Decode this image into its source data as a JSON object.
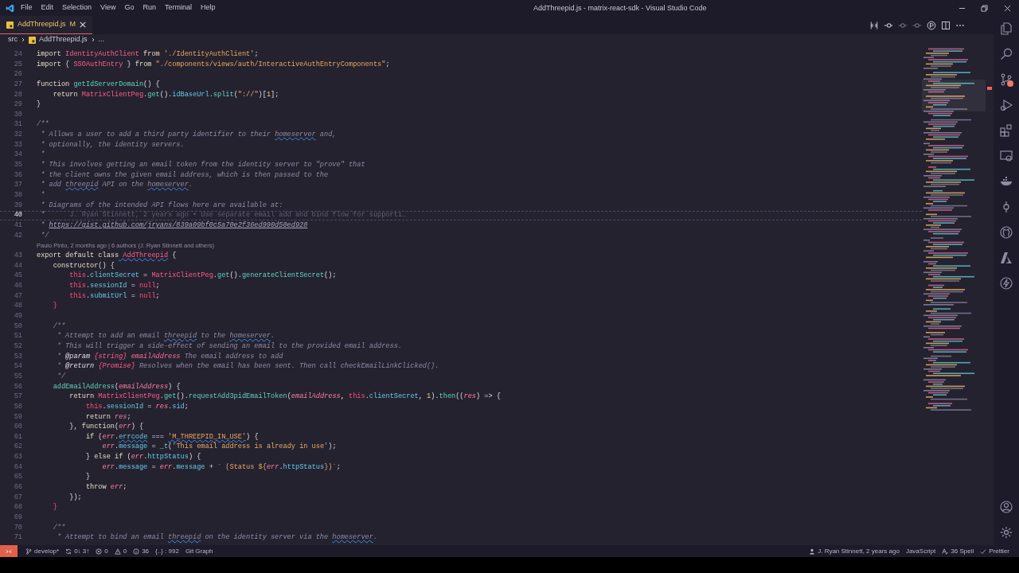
{
  "window": {
    "title": "AddThreepid.js - matrix-react-sdk - Visual Studio Code"
  },
  "menu": [
    "File",
    "Edit",
    "Selection",
    "View",
    "Go",
    "Run",
    "Terminal",
    "Help"
  ],
  "tabs": [
    {
      "label": "AddThreepid.js",
      "status": "M",
      "selected": true
    }
  ],
  "breadcrumb": [
    "src",
    "AddThreepid.js",
    "..."
  ],
  "editor": {
    "lines": [
      {
        "kind": "code",
        "number": "24",
        "current": false,
        "tokens": [
          {
            "kind": "kw",
            "text": "import"
          },
          {
            "kind": "cls",
            "text": " IdentityAuthClient"
          },
          {
            "kind": "kw",
            "text": " from"
          },
          {
            "kind": "str",
            "text": " './IdentityAuthClient'"
          },
          {
            "kind": "p",
            "text": ";"
          }
        ]
      },
      {
        "kind": "code",
        "number": "25",
        "current": false,
        "tokens": [
          {
            "kind": "kw",
            "text": "import"
          },
          {
            "kind": "p",
            "text": " { "
          },
          {
            "kind": "cls",
            "text": "SSOAuthEntry"
          },
          {
            "kind": "p",
            "text": " } "
          },
          {
            "kind": "kw",
            "text": "from"
          },
          {
            "kind": "str",
            "text": " \"./components/views/auth/InteractiveAuthEntryComponents\""
          },
          {
            "kind": "p",
            "text": ";"
          }
        ]
      },
      {
        "kind": "code",
        "number": "26",
        "current": false
      },
      {
        "kind": "code",
        "number": "27",
        "current": false,
        "tokens": [
          {
            "kind": "kw",
            "text": "function"
          },
          {
            "kind": "fn",
            "text": " getIdServerDomain"
          },
          {
            "kind": "p",
            "text": "() {"
          }
        ]
      },
      {
        "kind": "code",
        "number": "28",
        "current": false,
        "tokens": [
          {
            "kind": "kw",
            "text": "    return"
          },
          {
            "kind": "cls",
            "text": " MatrixClientPeg"
          },
          {
            "kind": "p",
            "text": "."
          },
          {
            "kind": "fn",
            "text": "get"
          },
          {
            "kind": "p",
            "text": "()."
          },
          {
            "kind": "prop",
            "text": "idBaseUrl"
          },
          {
            "kind": "p",
            "text": "."
          },
          {
            "kind": "fn",
            "text": "split"
          },
          {
            "kind": "p",
            "text": "("
          },
          {
            "kind": "str",
            "text": "\"://\""
          },
          {
            "kind": "p",
            "text": ")["
          },
          {
            "kind": "num",
            "text": "1"
          },
          {
            "kind": "p",
            "text": "];"
          }
        ]
      },
      {
        "kind": "code",
        "number": "29",
        "current": false,
        "tokens": [
          {
            "kind": "p",
            "text": "}"
          }
        ]
      },
      {
        "kind": "code",
        "number": "30",
        "current": false
      },
      {
        "kind": "code",
        "number": "31",
        "current": false,
        "tokens": [
          {
            "kind": "cmt",
            "text": "/**"
          }
        ]
      },
      {
        "kind": "code",
        "number": "32",
        "current": false,
        "tokens": [
          {
            "kind": "cmt",
            "text": " * Allows a user to add a third party identifier to their "
          },
          {
            "kind": "cmtspell",
            "text": "homeserver"
          },
          {
            "kind": "cmt",
            "text": " and,"
          }
        ]
      },
      {
        "kind": "code",
        "number": "33",
        "current": false,
        "tokens": [
          {
            "kind": "cmt",
            "text": " * optionally, the identity servers."
          }
        ]
      },
      {
        "kind": "code",
        "number": "34",
        "current": false,
        "tokens": [
          {
            "kind": "cmt",
            "text": " *"
          }
        ]
      },
      {
        "kind": "code",
        "number": "35",
        "current": false,
        "tokens": [
          {
            "kind": "cmt",
            "text": " * This involves getting an email token from the identity server to \"prove\" that"
          }
        ]
      },
      {
        "kind": "code",
        "number": "36",
        "current": false,
        "tokens": [
          {
            "kind": "cmt",
            "text": " * the client owns the given email address, which is then passed to the"
          }
        ]
      },
      {
        "kind": "code",
        "number": "37",
        "current": false,
        "tokens": [
          {
            "kind": "cmt",
            "text": " * add "
          },
          {
            "kind": "cmtspell",
            "text": "threepid"
          },
          {
            "kind": "cmt",
            "text": " API on the "
          },
          {
            "kind": "cmtspell",
            "text": "homeserver"
          },
          {
            "kind": "cmt",
            "text": "."
          }
        ]
      },
      {
        "kind": "code",
        "number": "38",
        "current": false,
        "tokens": [
          {
            "kind": "cmt",
            "text": " *"
          }
        ]
      },
      {
        "kind": "code",
        "number": "39",
        "current": false,
        "tokens": [
          {
            "kind": "cmt",
            "text": " * Diagrams of the intended API flows here are available at:"
          }
        ]
      },
      {
        "kind": "code",
        "number": "40",
        "current": true,
        "tokens": [
          {
            "kind": "cmt",
            "text": " *"
          },
          {
            "kind": "ghost",
            "text": "      J. Ryan Stinnett, 2 years ago • Use separate email add and bind flow for supporti…"
          }
        ]
      },
      {
        "kind": "code",
        "number": "41",
        "current": false,
        "tokens": [
          {
            "kind": "cmt",
            "text": " * "
          },
          {
            "kind": "link",
            "text": "https://gist.github.com/jryans/839a09bf0c5a70e2f36ed990d50ed928"
          }
        ]
      },
      {
        "kind": "code",
        "number": "42",
        "current": false,
        "tokens": [
          {
            "kind": "cmt",
            "text": " */"
          }
        ]
      },
      {
        "kind": "codelens",
        "text": "Paulo Pinto, 2 months ago | 6 authors (J. Ryan Stinnett and others)"
      },
      {
        "kind": "code",
        "number": "43",
        "current": false,
        "tokens": [
          {
            "kind": "kw",
            "text": "export default class"
          },
          {
            "kind": "clsspell",
            "text": " AddThreepid"
          },
          {
            "kind": "p",
            "text": " {"
          }
        ]
      },
      {
        "kind": "code",
        "number": "44",
        "current": false,
        "tokens": [
          {
            "kind": "kw",
            "text": "    constructor"
          },
          {
            "kind": "p",
            "text": "() {"
          }
        ]
      },
      {
        "kind": "code",
        "number": "45",
        "current": false,
        "tokens": [
          {
            "kind": "this",
            "text": "        this"
          },
          {
            "kind": "p",
            "text": "."
          },
          {
            "kind": "prop",
            "text": "clientSecret"
          },
          {
            "kind": "p",
            "text": " = "
          },
          {
            "kind": "cls",
            "text": "MatrixClientPeg"
          },
          {
            "kind": "p",
            "text": "."
          },
          {
            "kind": "fn",
            "text": "get"
          },
          {
            "kind": "p",
            "text": "()."
          },
          {
            "kind": "fn",
            "text": "generateClientSecret"
          },
          {
            "kind": "p",
            "text": "();"
          }
        ]
      },
      {
        "kind": "code",
        "number": "46",
        "current": false,
        "tokens": [
          {
            "kind": "this",
            "text": "        this"
          },
          {
            "kind": "p",
            "text": "."
          },
          {
            "kind": "prop",
            "text": "sessionId"
          },
          {
            "kind": "p",
            "text": " = "
          },
          {
            "kind": "this",
            "text": "null"
          },
          {
            "kind": "p",
            "text": ";"
          }
        ]
      },
      {
        "kind": "code",
        "number": "47",
        "current": false,
        "tokens": [
          {
            "kind": "this",
            "text": "        this"
          },
          {
            "kind": "p",
            "text": "."
          },
          {
            "kind": "prop",
            "text": "submitUrl"
          },
          {
            "kind": "p",
            "text": " = "
          },
          {
            "kind": "this",
            "text": "null"
          },
          {
            "kind": "p",
            "text": ";"
          }
        ]
      },
      {
        "kind": "code",
        "number": "48",
        "current": false,
        "tokens": [
          {
            "kind": "brace",
            "text": "    }"
          }
        ]
      },
      {
        "kind": "code",
        "number": "49",
        "current": false
      },
      {
        "kind": "code",
        "number": "50",
        "current": false,
        "tokens": [
          {
            "kind": "cmt",
            "text": "    /**"
          }
        ]
      },
      {
        "kind": "code",
        "number": "51",
        "current": false,
        "tokens": [
          {
            "kind": "cmt",
            "text": "     * Attempt to add an email "
          },
          {
            "kind": "cmtspell",
            "text": "threepid"
          },
          {
            "kind": "cmt",
            "text": " to the "
          },
          {
            "kind": "cmtspell",
            "text": "homeserver"
          },
          {
            "kind": "cmt",
            "text": "."
          }
        ]
      },
      {
        "kind": "code",
        "number": "52",
        "current": false,
        "tokens": [
          {
            "kind": "cmt",
            "text": "     * This will trigger a side-effect of sending an email to the provided email address."
          }
        ]
      },
      {
        "kind": "code",
        "number": "53",
        "current": false,
        "tokens": [
          {
            "kind": "cmt",
            "text": "     * "
          },
          {
            "kind": "doctag",
            "text": "@param"
          },
          {
            "kind": "doctype",
            "text": " {string}"
          },
          {
            "kind": "docvar",
            "text": " emailAddress"
          },
          {
            "kind": "cmt",
            "text": " The email address to add"
          }
        ]
      },
      {
        "kind": "code",
        "number": "54",
        "current": false,
        "tokens": [
          {
            "kind": "cmt",
            "text": "     * "
          },
          {
            "kind": "doctag",
            "text": "@return"
          },
          {
            "kind": "doctype",
            "text": " {Promise}"
          },
          {
            "kind": "cmt",
            "text": " Resolves when the email has been sent. Then call checkEmailLinkClicked()."
          }
        ]
      },
      {
        "kind": "code",
        "number": "55",
        "current": false,
        "tokens": [
          {
            "kind": "cmt",
            "text": "     */"
          }
        ]
      },
      {
        "kind": "code",
        "number": "56",
        "current": false,
        "tokens": [
          {
            "kind": "fn",
            "text": "    addEmailAddress"
          },
          {
            "kind": "p",
            "text": "("
          },
          {
            "kind": "var",
            "text": "emailAddress"
          },
          {
            "kind": "p",
            "text": ") {"
          }
        ]
      },
      {
        "kind": "code",
        "number": "57",
        "current": false,
        "tokens": [
          {
            "kind": "kw",
            "text": "        return"
          },
          {
            "kind": "cls",
            "text": " MatrixClientPeg"
          },
          {
            "kind": "p",
            "text": "."
          },
          {
            "kind": "fn",
            "text": "get"
          },
          {
            "kind": "p",
            "text": "()."
          },
          {
            "kind": "fn",
            "text": "requestAdd3pidEmailToken"
          },
          {
            "kind": "p",
            "text": "("
          },
          {
            "kind": "var",
            "text": "emailAddress"
          },
          {
            "kind": "p",
            "text": ", "
          },
          {
            "kind": "this",
            "text": "this"
          },
          {
            "kind": "p",
            "text": "."
          },
          {
            "kind": "prop",
            "text": "clientSecret"
          },
          {
            "kind": "p",
            "text": ", "
          },
          {
            "kind": "num",
            "text": "1"
          },
          {
            "kind": "p",
            "text": ")."
          },
          {
            "kind": "fn",
            "text": "then"
          },
          {
            "kind": "p",
            "text": "(("
          },
          {
            "kind": "var",
            "text": "res"
          },
          {
            "kind": "p",
            "text": ") => {"
          }
        ]
      },
      {
        "kind": "code",
        "number": "58",
        "current": false,
        "tokens": [
          {
            "kind": "this",
            "text": "            this"
          },
          {
            "kind": "p",
            "text": "."
          },
          {
            "kind": "prop",
            "text": "sessionId"
          },
          {
            "kind": "p",
            "text": " = "
          },
          {
            "kind": "var",
            "text": "res"
          },
          {
            "kind": "p",
            "text": "."
          },
          {
            "kind": "prop",
            "text": "sid"
          },
          {
            "kind": "p",
            "text": ";"
          }
        ]
      },
      {
        "kind": "code",
        "number": "59",
        "current": false,
        "tokens": [
          {
            "kind": "kw",
            "text": "            return"
          },
          {
            "kind": "var",
            "text": " res"
          },
          {
            "kind": "p",
            "text": ";"
          }
        ]
      },
      {
        "kind": "code",
        "number": "60",
        "current": false,
        "tokens": [
          {
            "kind": "p",
            "text": "        }, "
          },
          {
            "kind": "kw",
            "text": "function"
          },
          {
            "kind": "p",
            "text": "("
          },
          {
            "kind": "var",
            "text": "err"
          },
          {
            "kind": "p",
            "text": ") {"
          }
        ]
      },
      {
        "kind": "code",
        "number": "61",
        "current": false,
        "tokens": [
          {
            "kind": "kw",
            "text": "            if"
          },
          {
            "kind": "p",
            "text": " ("
          },
          {
            "kind": "var",
            "text": "err"
          },
          {
            "kind": "p",
            "text": "."
          },
          {
            "kind": "propspell",
            "text": "errcode"
          },
          {
            "kind": "p",
            "text": " === "
          },
          {
            "kind": "strspell",
            "text": "'M_THREEPID_IN_USE'"
          },
          {
            "kind": "p",
            "text": ") {"
          }
        ]
      },
      {
        "kind": "code",
        "number": "62",
        "current": false,
        "tokens": [
          {
            "kind": "var",
            "text": "                err"
          },
          {
            "kind": "p",
            "text": "."
          },
          {
            "kind": "prop",
            "text": "message"
          },
          {
            "kind": "p",
            "text": " = "
          },
          {
            "kind": "fn",
            "text": "_t"
          },
          {
            "kind": "p",
            "text": "("
          },
          {
            "kind": "str",
            "text": "'This email address is already in use'"
          },
          {
            "kind": "p",
            "text": ");"
          }
        ]
      },
      {
        "kind": "code",
        "number": "63",
        "current": false,
        "tokens": [
          {
            "kind": "p",
            "text": "            } "
          },
          {
            "kind": "kw",
            "text": "else if"
          },
          {
            "kind": "p",
            "text": " ("
          },
          {
            "kind": "var",
            "text": "err"
          },
          {
            "kind": "p",
            "text": "."
          },
          {
            "kind": "prop",
            "text": "httpStatus"
          },
          {
            "kind": "p",
            "text": ") {"
          }
        ]
      },
      {
        "kind": "code",
        "number": "64",
        "current": false,
        "tokens": [
          {
            "kind": "var",
            "text": "                err"
          },
          {
            "kind": "p",
            "text": "."
          },
          {
            "kind": "prop",
            "text": "message"
          },
          {
            "kind": "p",
            "text": " = "
          },
          {
            "kind": "var",
            "text": "err"
          },
          {
            "kind": "p",
            "text": "."
          },
          {
            "kind": "prop",
            "text": "message"
          },
          {
            "kind": "p",
            "text": " + "
          },
          {
            "kind": "str",
            "text": "` (Status ${"
          },
          {
            "kind": "var",
            "text": "err"
          },
          {
            "kind": "p",
            "text": "."
          },
          {
            "kind": "prop",
            "text": "httpStatus"
          },
          {
            "kind": "str",
            "text": "})`"
          },
          {
            "kind": "p",
            "text": ";"
          }
        ]
      },
      {
        "kind": "code",
        "number": "65",
        "current": false,
        "tokens": [
          {
            "kind": "p",
            "text": "            }"
          }
        ]
      },
      {
        "kind": "code",
        "number": "66",
        "current": false,
        "tokens": [
          {
            "kind": "kw",
            "text": "            throw"
          },
          {
            "kind": "var",
            "text": " err"
          },
          {
            "kind": "p",
            "text": ";"
          }
        ]
      },
      {
        "kind": "code",
        "number": "67",
        "current": false,
        "tokens": [
          {
            "kind": "p",
            "text": "        });"
          }
        ]
      },
      {
        "kind": "code",
        "number": "68",
        "current": false,
        "tokens": [
          {
            "kind": "brace",
            "text": "    }"
          }
        ]
      },
      {
        "kind": "code",
        "number": "69",
        "current": false
      },
      {
        "kind": "code",
        "number": "70",
        "current": false,
        "tokens": [
          {
            "kind": "cmt",
            "text": "    /**"
          }
        ]
      },
      {
        "kind": "code",
        "number": "71",
        "current": false,
        "tokens": [
          {
            "kind": "cmt",
            "text": "     * Attempt to bind an email "
          },
          {
            "kind": "cmtspell",
            "text": "threepid"
          },
          {
            "kind": "cmt",
            "text": " on the identity server via the "
          },
          {
            "kind": "cmtspell",
            "text": "homeserver"
          },
          {
            "kind": "cmt",
            "text": "."
          }
        ]
      }
    ]
  },
  "status_bar": {
    "left": [
      {
        "kind": "branch",
        "text": "develop*"
      },
      {
        "kind": "sync",
        "text": "0↓ 3↑"
      },
      {
        "kind": "errors",
        "text": "0"
      },
      {
        "kind": "warnings",
        "text": "0"
      },
      {
        "kind": "info",
        "text": "36"
      },
      {
        "kind": "plain",
        "text": "{..} : 992"
      },
      {
        "kind": "plain",
        "text": "Git Graph"
      }
    ],
    "right": [
      {
        "kind": "person",
        "text": "J. Ryan Stinnett, 2 years ago"
      },
      {
        "kind": "plain",
        "text": "JavaScript"
      },
      {
        "kind": "spell",
        "text": "36 Spell"
      },
      {
        "kind": "check",
        "text": "Prettier"
      }
    ]
  }
}
